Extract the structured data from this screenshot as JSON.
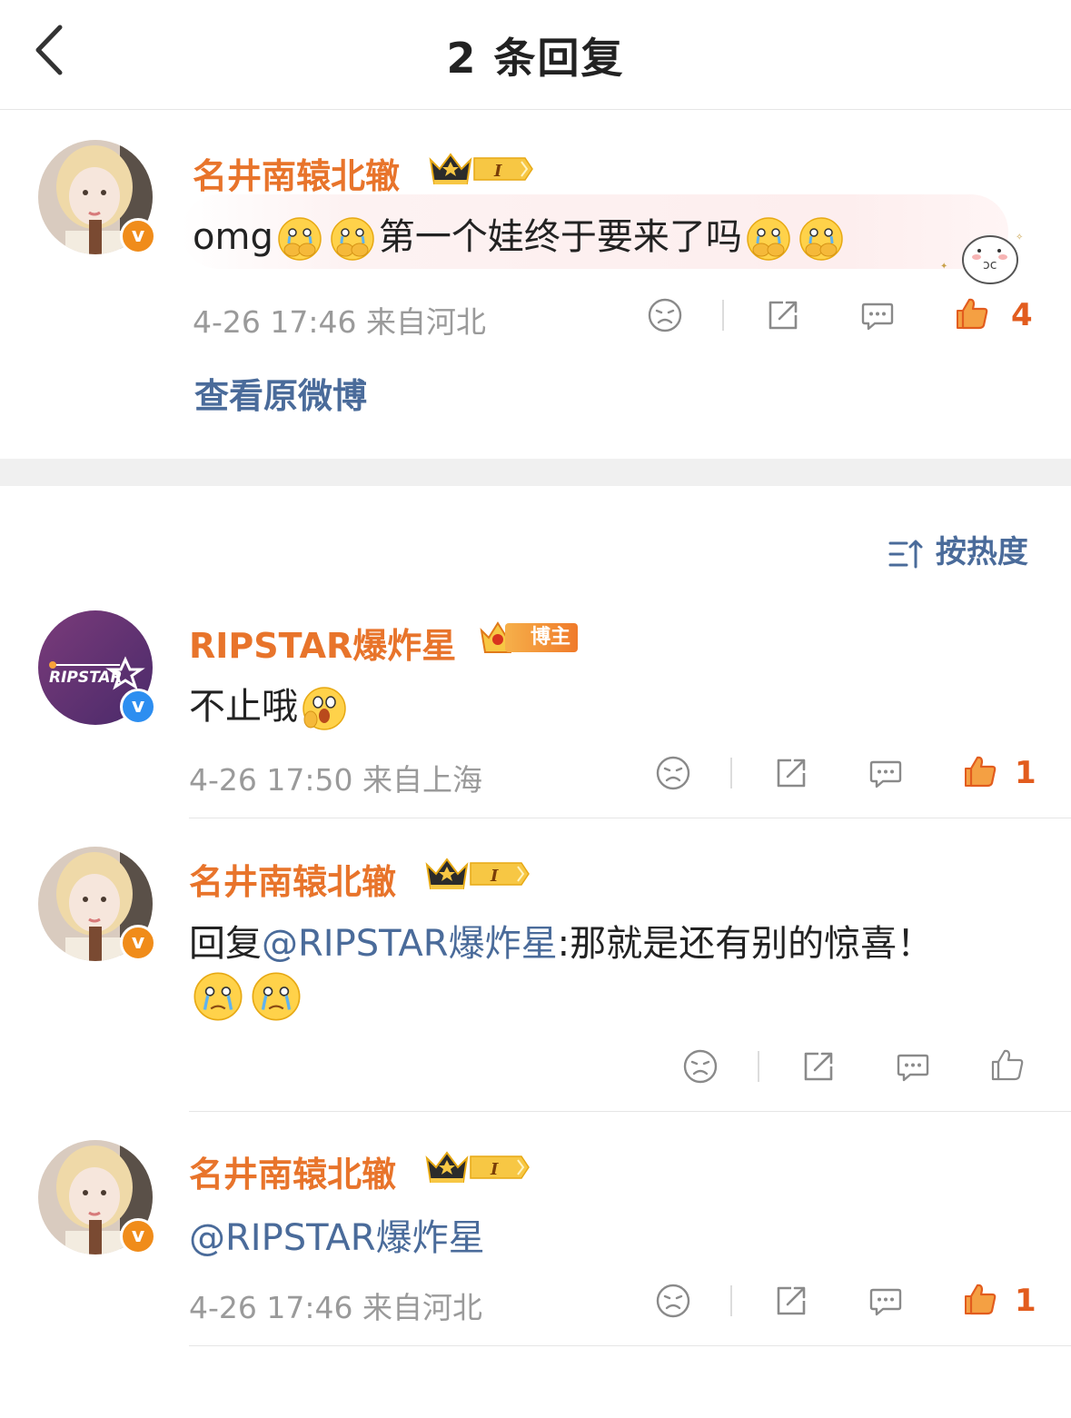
{
  "header": {
    "title": "2 条回复"
  },
  "root_comment": {
    "username": "名井南辕北辙",
    "text": "omg",
    "text2": "第一个娃终于要来了吗",
    "timestamp": "4-26 17:46",
    "location": "来自河北",
    "likes": "4",
    "view_original": "查看原微博"
  },
  "sort": {
    "label": "按热度"
  },
  "replies": [
    {
      "username": "RIPSTAR爆炸星",
      "badge": "博主",
      "avatar_text": "RIPSTAR",
      "text": "不止哦",
      "timestamp": "4-26 17:50",
      "location": "来自上海",
      "likes": "1"
    },
    {
      "username": "名井南辕北辙",
      "reply_prefix": "回复",
      "mention": "@RIPSTAR爆炸星",
      "text": ":那就是还有别的惊喜！"
    },
    {
      "username": "名井南辕北辙",
      "mention": "@RIPSTAR爆炸星",
      "timestamp": "4-26 17:46",
      "location": "来自河北",
      "likes": "1"
    }
  ],
  "colors": {
    "username": "#e8742b",
    "mention": "#4a6b9a",
    "meta": "#9a9a9a",
    "like_active": "#e25c1e"
  },
  "icons": [
    "back-icon",
    "dislike-icon",
    "share-icon",
    "comment-icon",
    "like-icon",
    "sort-icon",
    "crown-badge-icon",
    "verified-icon"
  ]
}
